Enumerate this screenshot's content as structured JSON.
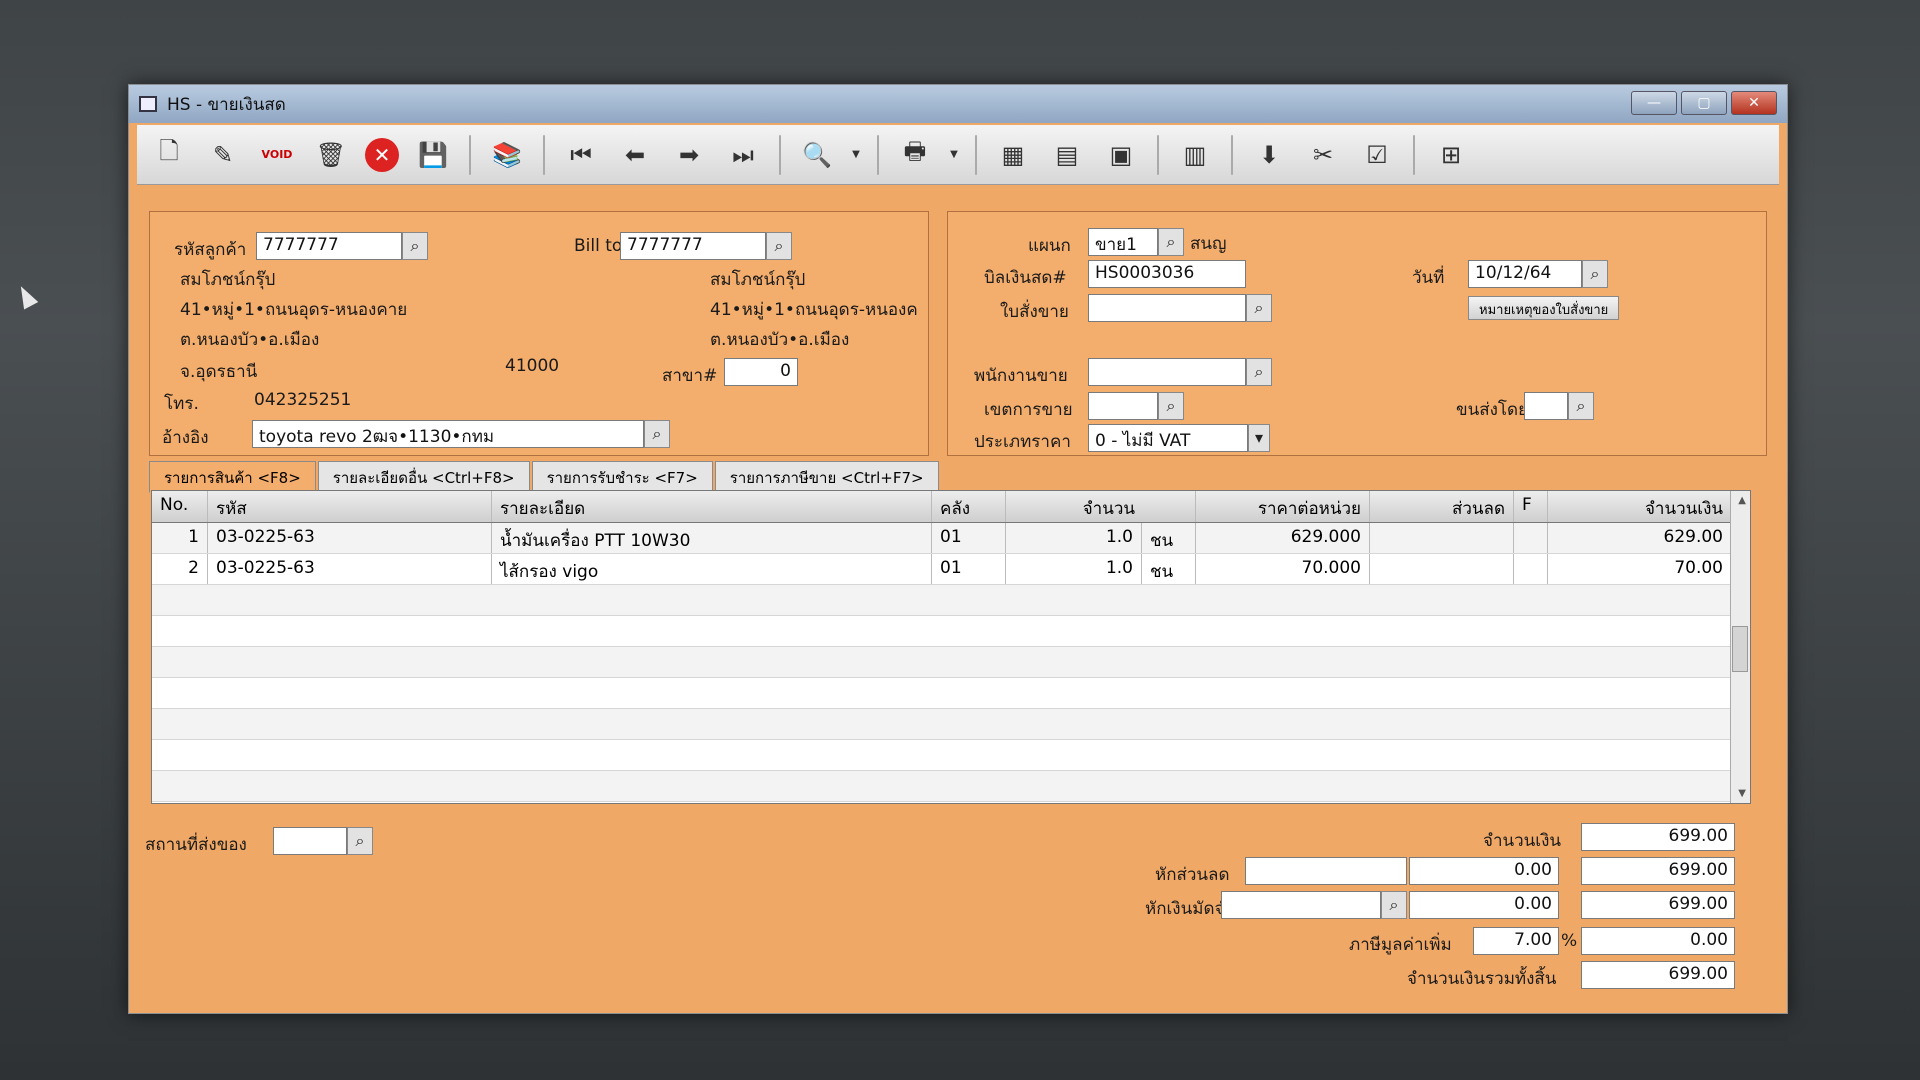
{
  "window": {
    "title": "HS - ขายเงินสด",
    "min": "—",
    "max": "▢",
    "close": "✕"
  },
  "toolbar": {
    "items": [
      "new-icon",
      "edit-icon",
      "void-icon",
      "delete-icon",
      "cancel-icon",
      "save-icon",
      "attach-icon",
      "first-icon",
      "prev-icon",
      "next-icon",
      "last-icon",
      "preview-icon",
      "print-icon",
      "calc-icon",
      "register-icon",
      "vat-icon",
      "report-icon",
      "approve-icon",
      "tools-icon",
      "ok-icon",
      "network-icon"
    ],
    "void_text": "VOID"
  },
  "customer": {
    "code_label": "รหัสลูกค้า",
    "code": "7777777",
    "name": "สมโภชน์กรุ๊ป",
    "addr1": "41•หมู่•1•ถนนอุดร-หนองคาย",
    "addr2": "ต.หนองบัว•อ.เมือง",
    "addr3": "จ.อุดรธานี",
    "zip": "41000",
    "tel_label": "โทร.",
    "tel": "042325251",
    "ref_label": "อ้างอิง",
    "ref": "toyota revo 2ฒจ•1130•กทม"
  },
  "billto": {
    "label": "Bill to",
    "code": "7777777",
    "name": "สมโภชน์กรุ๊ป",
    "addr1": "41•หมู่•1•ถนนอุดร-หนองค",
    "addr2": "ต.หนองบัว•อ.เมือง",
    "branch_label": "สาขา#",
    "branch": "0"
  },
  "doc": {
    "dept_label": "แผนก",
    "dept": "ขาย1",
    "dept_name": "สนญ",
    "bill_label": "บิลเงินสด#",
    "bill": "HS0003036",
    "date_label": "วันที่",
    "date": "10/12/64",
    "order_label": "ใบสั่งขาย",
    "order": "",
    "note_btn": "หมายเหตุของใบสั่งขาย",
    "sales_label": "พนักงานขาย",
    "sales": "",
    "zone_label": "เขตการขาย",
    "zone": "",
    "ship_label": "ขนส่งโดย",
    "ship": "",
    "price_label": "ประเภทราคา",
    "price_type": "0 - ไม่มี VAT"
  },
  "tabs": [
    "รายการสินค้า <F8>",
    "รายละเอียดอื่น <Ctrl+F8>",
    "รายการรับชำระ <F7>",
    "รายการภาษีขาย <Ctrl+F7>"
  ],
  "grid": {
    "headers": [
      "No.",
      "รหัส",
      "รายละเอียด",
      "คลัง",
      "จำนวน",
      "ราคาต่อหน่วย",
      "ส่วนลด",
      "F",
      "จำนวนเงิน"
    ],
    "rows": [
      {
        "no": "1",
        "code": "03-0225-63",
        "desc": "น้ำมันเครื่อง PTT 10W30",
        "wh": "01",
        "qty": "1.0",
        "unit": "ชน",
        "price": "629.000",
        "disc": "",
        "f": "",
        "amount": "629.00"
      },
      {
        "no": "2",
        "code": "03-0225-63",
        "desc": "ไส้กรอง vigo",
        "wh": "01",
        "qty": "1.0",
        "unit": "ชน",
        "price": "70.000",
        "disc": "",
        "f": "",
        "amount": "70.00"
      }
    ]
  },
  "footer": {
    "delivery_label": "สถานที่ส่งของ",
    "delivery": "",
    "amount_label": "จำนวนเงิน",
    "amount": "699.00",
    "discount_label": "หักส่วนลด",
    "discount_text": "",
    "discount": "0.00",
    "after_discount": "699.00",
    "deposit_label": "หักเงินมัดจำ",
    "deposit_text": "",
    "deposit": "0.00",
    "after_deposit": "699.00",
    "vat_label": "ภาษีมูลค่าเพิ่ม",
    "vat_rate": "7.00",
    "pct": "%",
    "vat": "0.00",
    "total_label": "จำนวนเงินรวมทั้งสิ้น",
    "total": "699.00"
  }
}
